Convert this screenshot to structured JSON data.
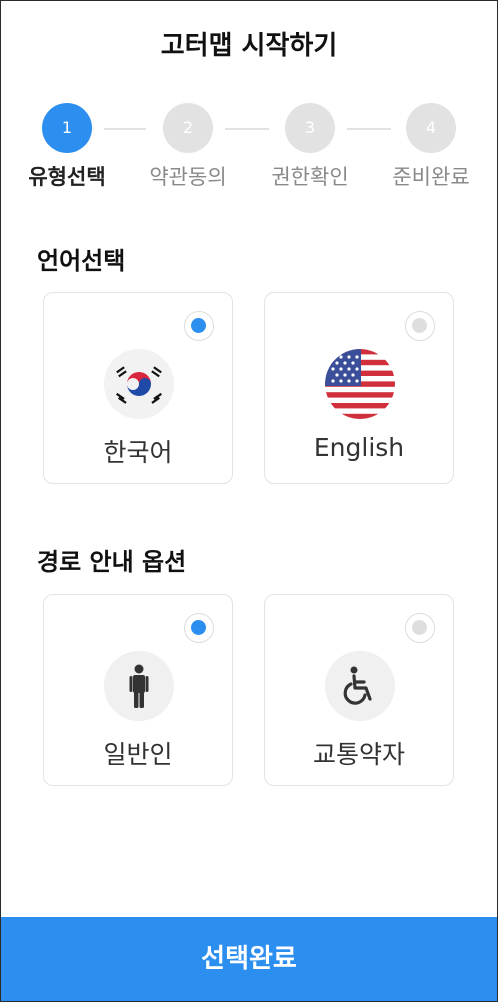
{
  "header": {
    "title": "고터맵 시작하기"
  },
  "stepper": {
    "steps": [
      {
        "number": "1",
        "label": "유형선택"
      },
      {
        "number": "2",
        "label": "약관동의"
      },
      {
        "number": "3",
        "label": "권한확인"
      },
      {
        "number": "4",
        "label": "준비완료"
      }
    ],
    "active_step": 1
  },
  "language": {
    "section_title": "언어선택",
    "options": [
      {
        "label": "한국어",
        "icon": "korea-flag-icon",
        "selected": true
      },
      {
        "label": "English",
        "icon": "usa-flag-icon",
        "selected": false
      }
    ]
  },
  "route": {
    "section_title": "경로 안내 옵션",
    "options": [
      {
        "label": "일반인",
        "icon": "person-icon",
        "selected": true
      },
      {
        "label": "교통약자",
        "icon": "wheelchair-icon",
        "selected": false
      }
    ]
  },
  "footer": {
    "button_label": "선택완료"
  },
  "colors": {
    "accent": "#2c8ff0",
    "inactive": "#e2e2e2"
  }
}
